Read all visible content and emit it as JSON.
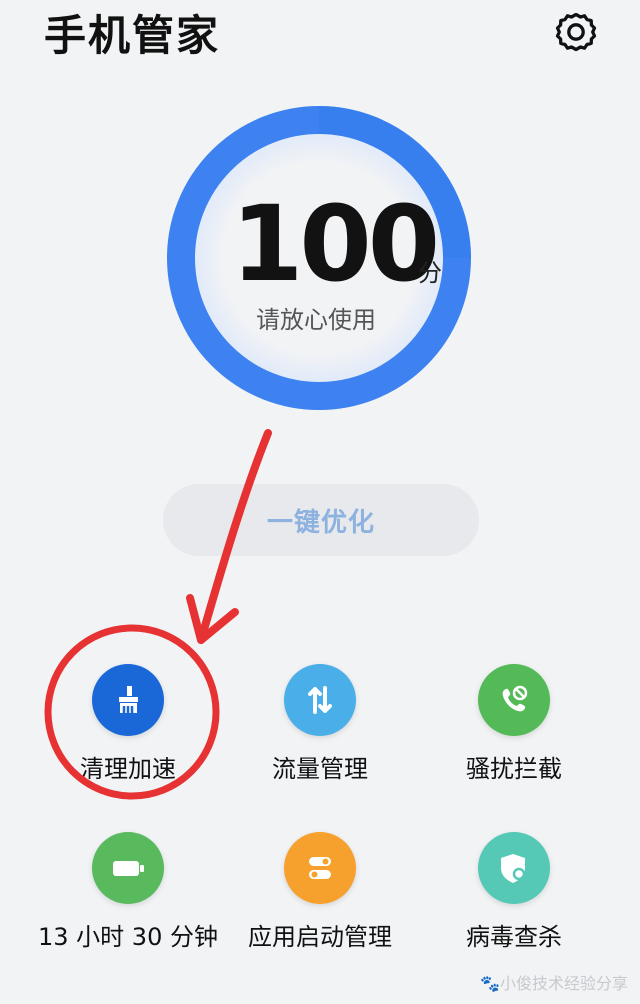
{
  "header": {
    "title": "手机管家"
  },
  "score": {
    "value": "100",
    "unit": "分",
    "status": "请放心使用"
  },
  "actions": {
    "optimize_label": "一键优化"
  },
  "tools": [
    {
      "label": "清理加速",
      "icon": "broom-icon",
      "color": "#1a67d8"
    },
    {
      "label": "流量管理",
      "icon": "traffic-arrows-icon",
      "color": "#4aaee8"
    },
    {
      "label": "骚扰拦截",
      "icon": "phone-block-icon",
      "color": "#54b957"
    },
    {
      "label": "13 小时 30 分钟",
      "icon": "battery-icon",
      "color": "#58b95d"
    },
    {
      "label": "应用启动管理",
      "icon": "toggle-switch-icon",
      "color": "#f6a12d"
    },
    {
      "label": "病毒查杀",
      "icon": "shield-search-icon",
      "color": "#56c8b6"
    }
  ],
  "watermark": "小俊技术经验分享",
  "colors": {
    "ring_blue": "#3d82f0",
    "annotation_red": "#e63232"
  }
}
